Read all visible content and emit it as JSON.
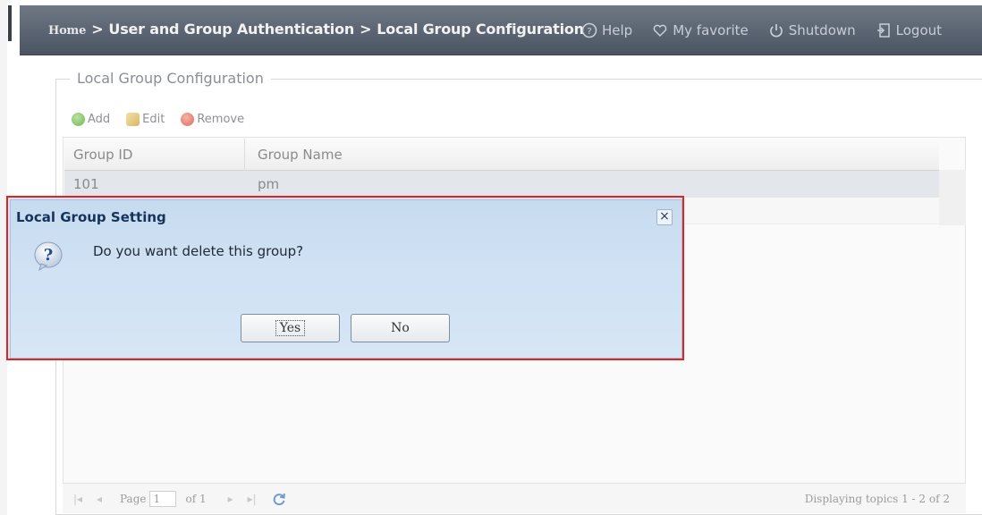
{
  "header": {
    "breadcrumb": {
      "home": "Home",
      "section": "User and Group Authentication",
      "page": "Local Group Configuration"
    },
    "tools": {
      "help": "Help",
      "favorite": "My favorite",
      "shutdown": "Shutdown",
      "logout": "Logout"
    }
  },
  "main": {
    "fieldset_title": "Local Group Configuration",
    "toolbar": {
      "add": "Add",
      "edit": "Edit",
      "remove": "Remove"
    },
    "grid": {
      "columns": [
        "Group ID",
        "Group Name"
      ],
      "rows": [
        {
          "group_id": "101",
          "group_name": "pm"
        }
      ]
    },
    "pager": {
      "page_label": "Page",
      "page_value": "1",
      "of_label": "of 1",
      "display_text": "Displaying topics 1 - 2 of 2"
    }
  },
  "dialog": {
    "title": "Local Group Setting",
    "message": "Do you want delete this group?",
    "yes_label": "Yes",
    "no_label": "No",
    "close_glyph": "×"
  },
  "colors": {
    "header_bg": "#596270",
    "dialog_bg": "#cfe1f3",
    "highlight_border": "#e02424"
  }
}
